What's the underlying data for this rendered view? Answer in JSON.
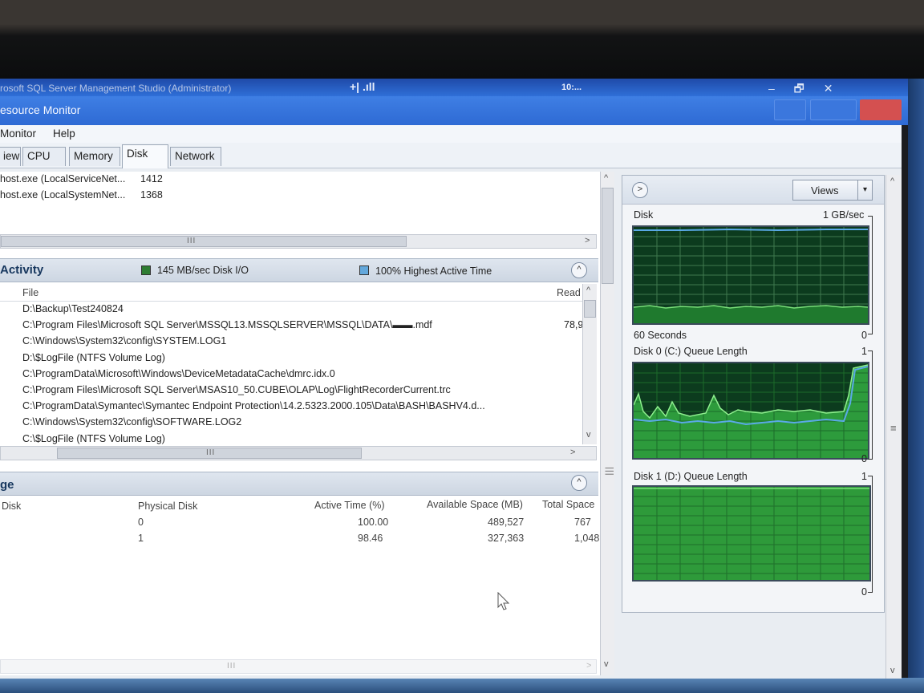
{
  "window": {
    "ssms_title": "rosoft SQL Server Management Studio (Administrator)",
    "signal_glyph": "+| .ıll",
    "time_glyph": "10:...",
    "controls": "– 🗗 ✕",
    "title": "esource Monitor"
  },
  "menu": {
    "items": [
      "Monitor",
      "Help"
    ]
  },
  "tabs": [
    "iew",
    "CPU",
    "Memory",
    "Disk",
    "Network"
  ],
  "active_tab": "Disk",
  "processes": {
    "rows": [
      {
        "image": "host.exe (LocalServiceNet...",
        "pid": "1412"
      },
      {
        "image": "host.exe (LocalSystemNet...",
        "pid": "1368"
      }
    ],
    "scroll_grip": "III",
    "scroll_right": ">"
  },
  "disk_activity": {
    "title": "Activity",
    "io_legend": "145 MB/sec Disk I/O",
    "active_legend": "100% Highest Active Time",
    "io_color": "#2e7d32",
    "active_color": "#63a8dc",
    "collapse": "^",
    "col_file": "File",
    "col_read": "Read",
    "files": [
      {
        "file": "D:\\Backup\\Test240824",
        "read": ""
      },
      {
        "file": "C:\\Program Files\\Microsoft SQL Server\\MSSQL13.MSSQLSERVER\\MSSQL\\DATA\\▬▬.mdf",
        "read": "78,9"
      },
      {
        "file": "C:\\Windows\\System32\\config\\SYSTEM.LOG1",
        "read": ""
      },
      {
        "file": "D:\\$LogFile (NTFS Volume Log)",
        "read": ""
      },
      {
        "file": "C:\\ProgramData\\Microsoft\\Windows\\DeviceMetadataCache\\dmrc.idx.0",
        "read": ""
      },
      {
        "file": "C:\\Program Files\\Microsoft SQL Server\\MSAS10_50.CUBE\\OLAP\\Log\\FlightRecorderCurrent.trc",
        "read": ""
      },
      {
        "file": "C:\\ProgramData\\Symantec\\Symantec Endpoint Protection\\14.2.5323.2000.105\\Data\\BASH\\BASHV4.d...",
        "read": ""
      },
      {
        "file": "C:\\Windows\\System32\\config\\SOFTWARE.LOG2",
        "read": ""
      },
      {
        "file": "C:\\$LogFile (NTFS Volume Log)",
        "read": ""
      }
    ],
    "scroll_grip": "III",
    "scroll_right": ">",
    "scroll_up": "^",
    "scroll_down": "v"
  },
  "storage": {
    "title": "ge",
    "collapse": "^",
    "columns": [
      "Disk",
      "Physical Disk",
      "Active Time (%)",
      "Available Space (MB)",
      "Total Space"
    ],
    "rows": [
      {
        "physical": "0",
        "active": "100.00",
        "available": "489,527",
        "total": "767"
      },
      {
        "physical": "1",
        "active": "98.46",
        "available": "327,363",
        "total": "1,048"
      }
    ],
    "scroll_grip": "III",
    "scroll_right": ">"
  },
  "graphs": {
    "expand": ">",
    "views": "Views",
    "views_drop": "▾",
    "splitter_grip": "|||",
    "right_grip": "≡",
    "disk": {
      "label": "Disk",
      "max": "1 GB/sec",
      "time": "60 Seconds",
      "min": "0"
    },
    "disk0": {
      "label": "Disk 0 (C:) Queue Length",
      "max": "1",
      "min": "0"
    },
    "disk1": {
      "label": "Disk 1 (D:) Queue Length",
      "max": "1",
      "min": "0"
    }
  }
}
